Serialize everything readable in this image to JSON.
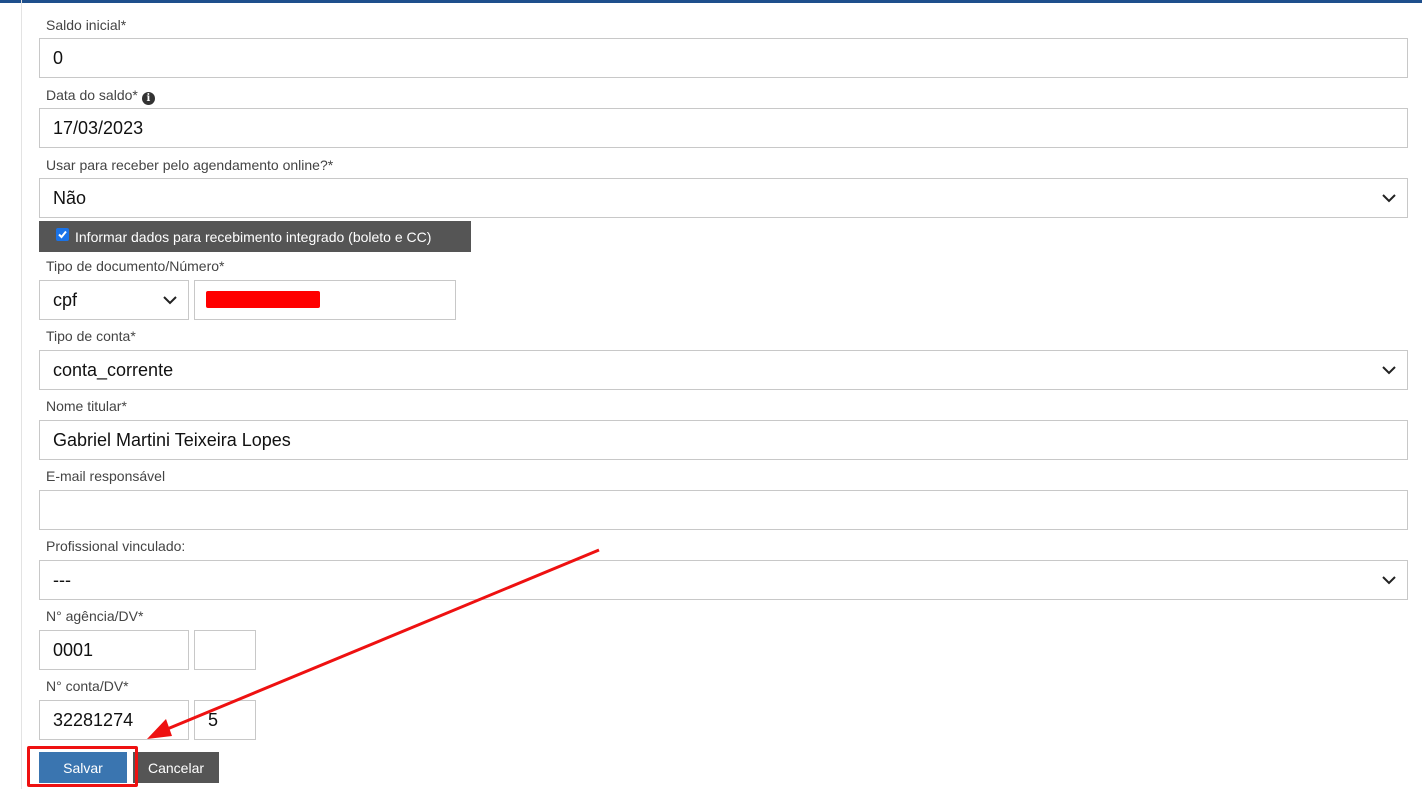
{
  "form": {
    "saldo_inicial": {
      "label": "Saldo inicial*",
      "value": "0"
    },
    "data_saldo": {
      "label": "Data do saldo*",
      "value": "17/03/2023",
      "info_icon": "info-icon"
    },
    "agendamento": {
      "label": "Usar para receber pelo agendamento online?*",
      "value": "Não"
    },
    "integrado_checkbox": {
      "label": "Informar dados para recebimento integrado (boleto e CC)",
      "checked": true
    },
    "tipo_documento": {
      "label": "Tipo de documento/Número*",
      "type_value": "cpf",
      "number_value": ""
    },
    "tipo_conta": {
      "label": "Tipo de conta*",
      "value": "conta_corrente"
    },
    "nome_titular": {
      "label": "Nome titular*",
      "value": "Gabriel Martini Teixeira Lopes"
    },
    "email_responsavel": {
      "label": "E-mail responsável",
      "value": ""
    },
    "profissional": {
      "label": "Profissional vinculado:",
      "value": "---"
    },
    "agencia": {
      "label": "N° agência/DV*",
      "value": "0001",
      "dv": ""
    },
    "conta": {
      "label": "N° conta/DV*",
      "value": "32281274",
      "dv": "5"
    }
  },
  "actions": {
    "save_label": "Salvar",
    "cancel_label": "Cancelar"
  },
  "colors": {
    "primary": "#3a75b0",
    "dark_button": "#555555",
    "annotation": "#e11111",
    "redaction": "#ff0000"
  }
}
